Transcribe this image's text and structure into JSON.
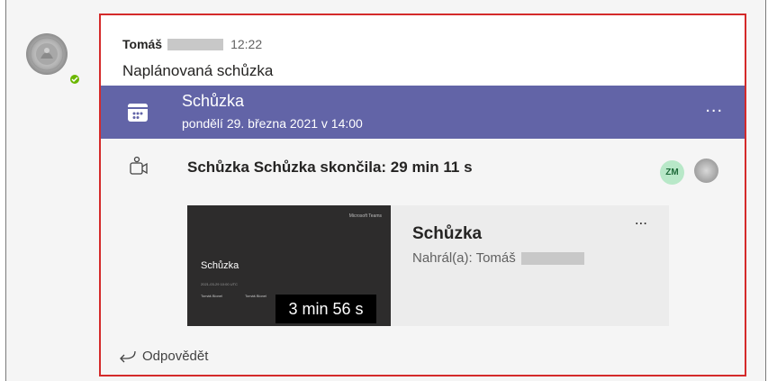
{
  "message": {
    "sender": "Tomáš",
    "time": "12:22",
    "text": "Naplánovaná schůzka"
  },
  "meeting": {
    "title": "Schůzka",
    "date": "pondělí 29. března 2021 v 14:00",
    "more_label": "...",
    "calendar_icon": "calendar-icon"
  },
  "ended": {
    "text": "Schůzka Schůzka skončila: 29 min 11 s",
    "icon": "meeting-camera-icon",
    "participants": [
      {
        "initials": "ZM",
        "color": "#b8e8c8"
      },
      {
        "initials": "",
        "type": "photo-avatar"
      }
    ]
  },
  "recording": {
    "title": "Schůzka",
    "recorded_by": "Nahrál(a): Tomáš",
    "duration": "3 min 56 s",
    "more_label": "...",
    "thumbnail": {
      "brand": "Microsoft Teams",
      "title": "Schůzka",
      "meta": "2021-03-29 10:00 UTC",
      "person1": "Tomáš Bionel",
      "person2": "Tomáš Bionel"
    }
  },
  "reply": {
    "label": "Odpovědět",
    "icon": "reply-arrow-icon"
  },
  "colors": {
    "meeting_bar": "#6264a7",
    "highlight_border": "#d42a2a",
    "presence": "#6bb700"
  }
}
